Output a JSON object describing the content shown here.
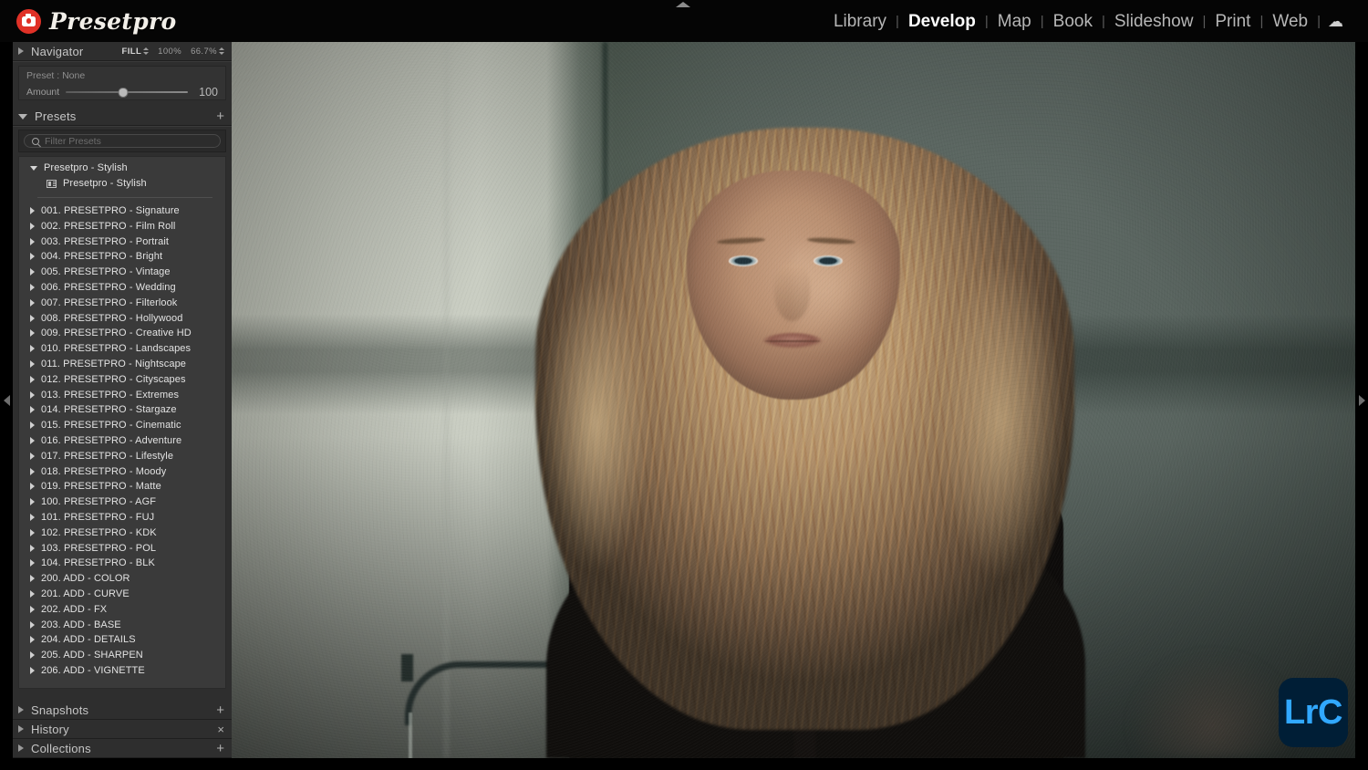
{
  "app": {
    "brand_name": "Presetpro",
    "brand_icon": "camera-icon",
    "badge": "LrC"
  },
  "modules": {
    "items": [
      {
        "label": "Library",
        "active": false
      },
      {
        "label": "Develop",
        "active": true
      },
      {
        "label": "Map",
        "active": false
      },
      {
        "label": "Book",
        "active": false
      },
      {
        "label": "Slideshow",
        "active": false
      },
      {
        "label": "Print",
        "active": false
      },
      {
        "label": "Web",
        "active": false
      }
    ],
    "separator": "|",
    "cloud_icon": "cloud-icon"
  },
  "navigator": {
    "title": "Navigator",
    "fit_mode": "FILL",
    "zoom_100": "100%",
    "zoom_custom": "66.7%"
  },
  "amount_panel": {
    "preset_label": "Preset : None",
    "amount_label": "Amount",
    "amount_value": "100",
    "slider_position_pct": 47
  },
  "presets": {
    "title": "Presets",
    "add_icon": "plus-icon",
    "filter_placeholder": "Filter Presets",
    "filter_value": "",
    "expanded_group": {
      "label": "Presetpro - Stylish",
      "children": [
        {
          "label": "Presetpro - Stylish"
        }
      ]
    },
    "folders": [
      {
        "label": "001. PRESETPRO - Signature"
      },
      {
        "label": "002. PRESETPRO - Film Roll"
      },
      {
        "label": "003. PRESETPRO - Portrait"
      },
      {
        "label": "004. PRESETPRO - Bright"
      },
      {
        "label": "005. PRESETPRO - Vintage"
      },
      {
        "label": "006. PRESETPRO - Wedding"
      },
      {
        "label": "007. PRESETPRO - Filterlook"
      },
      {
        "label": "008. PRESETPRO - Hollywood"
      },
      {
        "label": "009. PRESETPRO - Creative HD"
      },
      {
        "label": "010. PRESETPRO - Landscapes"
      },
      {
        "label": "011. PRESETPRO - Nightscape"
      },
      {
        "label": "012. PRESETPRO - Cityscapes"
      },
      {
        "label": "013. PRESETPRO - Extremes"
      },
      {
        "label": "014. PRESETPRO - Stargaze"
      },
      {
        "label": "015. PRESETPRO - Cinematic"
      },
      {
        "label": "016. PRESETPRO - Adventure"
      },
      {
        "label": "017. PRESETPRO - Lifestyle"
      },
      {
        "label": "018. PRESETPRO - Moody"
      },
      {
        "label": "019. PRESETPRO - Matte"
      },
      {
        "label": "100. PRESETPRO - AGF"
      },
      {
        "label": "101. PRESETPRO - FUJ"
      },
      {
        "label": "102. PRESETPRO - KDK"
      },
      {
        "label": "103. PRESETPRO - POL"
      },
      {
        "label": "104. PRESETPRO - BLK"
      },
      {
        "label": "200. ADD - COLOR"
      },
      {
        "label": "201. ADD - CURVE"
      },
      {
        "label": "202. ADD - FX"
      },
      {
        "label": "203. ADD - BASE"
      },
      {
        "label": "204. ADD - DETAILS"
      },
      {
        "label": "205. ADD - SHARPEN"
      },
      {
        "label": "206. ADD - VIGNETTE"
      }
    ]
  },
  "bottom_panels": [
    {
      "title": "Snapshots",
      "action_icon": "plus-icon",
      "action_glyph": "+"
    },
    {
      "title": "History",
      "action_icon": "close-icon",
      "action_glyph": "×"
    },
    {
      "title": "Collections",
      "action_icon": "plus-icon",
      "action_glyph": "+"
    }
  ],
  "colors": {
    "brand_red": "#e03127",
    "lrc_navy": "#001E36",
    "lrc_blue": "#31A8FF",
    "panel_bg": "#2e2e2e",
    "list_bg": "#3a3a3a"
  },
  "photo": {
    "description": "Portrait of a blonde woman with long wavy hair wearing a black top against a sage-green wall"
  }
}
